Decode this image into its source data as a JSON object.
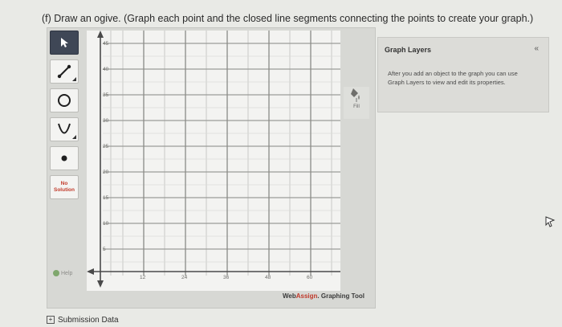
{
  "question": "(f) Draw an ogive. (Graph each point and the closed line segments connecting the points to create your graph.)",
  "toolbar": {
    "no_solution_line1": "No",
    "no_solution_line2": "Solution",
    "help_label": "Help"
  },
  "graph": {
    "y_ticks": [
      "45",
      "40",
      "35",
      "30",
      "25",
      "20",
      "15",
      "10",
      "5"
    ],
    "x_ticks": [
      "12",
      "24",
      "36",
      "48",
      "60"
    ],
    "fill_label": "Fill"
  },
  "layers_panel": {
    "title": "Graph Layers",
    "collapse": "«",
    "info": "After you add an object to the graph you can use Graph Layers to view and edit its properties."
  },
  "branding": {
    "web": "Web",
    "assign": "Assign",
    "tool": ". Graphing Tool"
  },
  "submission_label": "Submission Data"
}
